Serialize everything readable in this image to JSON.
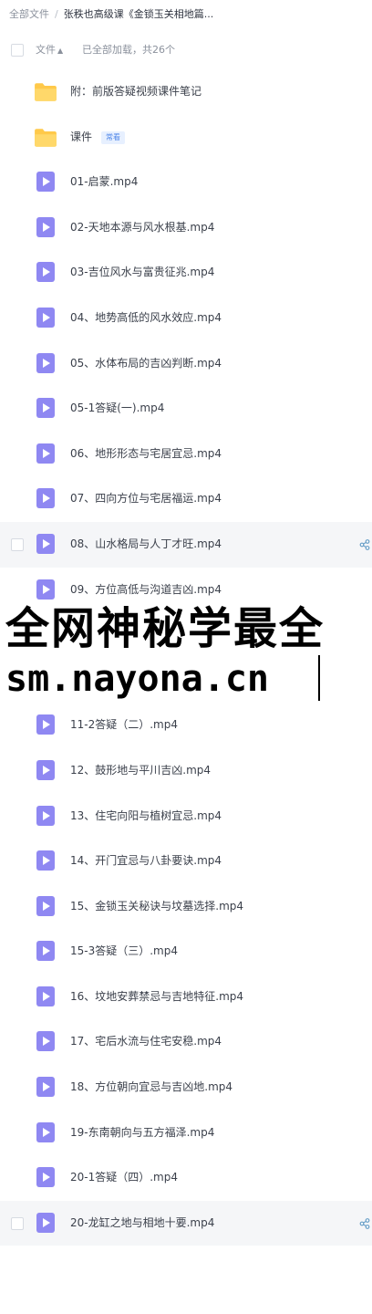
{
  "breadcrumb": {
    "root": "全部文件",
    "separator": "/",
    "current": "张秩也高级课《金锁玉关相地篇..."
  },
  "header": {
    "sort_label": "文件",
    "sort_arrow": "▲",
    "count_label": "已全部加载，共26个"
  },
  "items": [
    {
      "name": "附：前版答疑视频课件笔记",
      "type": "folder",
      "highlighted": false
    },
    {
      "name": "课件",
      "type": "folder",
      "tag": "常看",
      "highlighted": false
    },
    {
      "name": "01-启蒙.mp4",
      "type": "video",
      "highlighted": false
    },
    {
      "name": "02-天地本源与风水根基.mp4",
      "type": "video",
      "highlighted": false
    },
    {
      "name": "03-吉位风水与富贵征兆.mp4",
      "type": "video",
      "highlighted": false
    },
    {
      "name": "04、地势高低的风水效应.mp4",
      "type": "video",
      "highlighted": false
    },
    {
      "name": "05、水体布局的吉凶判断.mp4",
      "type": "video",
      "highlighted": false
    },
    {
      "name": "05-1答疑(一).mp4",
      "type": "video",
      "highlighted": false
    },
    {
      "name": "06、地形形态与宅居宜忌.mp4",
      "type": "video",
      "highlighted": false
    },
    {
      "name": "07、四向方位与宅居福运.mp4",
      "type": "video",
      "highlighted": false
    },
    {
      "name": "08、山水格局与人丁才旺.mp4",
      "type": "video",
      "highlighted": true
    },
    {
      "name": "09、方位高低与沟道吉凶.mp4",
      "type": "video",
      "highlighted": false
    },
    {
      "name": "",
      "type": "hidden",
      "highlighted": false
    },
    {
      "name": "",
      "type": "hidden",
      "highlighted": false
    },
    {
      "name": "11-2答疑（二）.mp4",
      "type": "video",
      "highlighted": false
    },
    {
      "name": "12、鼓形地与平川吉凶.mp4",
      "type": "video",
      "highlighted": false
    },
    {
      "name": "13、住宅向阳与植树宜忌.mp4",
      "type": "video",
      "highlighted": false
    },
    {
      "name": "14、开门宜忌与八卦要诀.mp4",
      "type": "video",
      "highlighted": false
    },
    {
      "name": "15、金锁玉关秘诀与坟墓选择.mp4",
      "type": "video",
      "highlighted": false
    },
    {
      "name": "15-3答疑（三）.mp4",
      "type": "video",
      "highlighted": false
    },
    {
      "name": "16、坟地安葬禁忌与吉地特征.mp4",
      "type": "video",
      "highlighted": false
    },
    {
      "name": "17、宅后水流与住宅安稳.mp4",
      "type": "video",
      "highlighted": false
    },
    {
      "name": "18、方位朝向宜忌与吉凶地.mp4",
      "type": "video",
      "highlighted": false
    },
    {
      "name": "19-东南朝向与五方福泽.mp4",
      "type": "video",
      "highlighted": false
    },
    {
      "name": "20-1答疑（四）.mp4",
      "type": "video",
      "highlighted": false
    },
    {
      "name": "20-龙缸之地与相地十要.mp4",
      "type": "video",
      "highlighted": true
    }
  ],
  "watermark": {
    "line1": "全网神秘学最全",
    "line2": "sm.nayona.cn"
  },
  "colors": {
    "folder": "#ffc94a",
    "video": "#8f88f2",
    "share": "#6aa0c8",
    "highlight_row": "#f5f6f8"
  },
  "icons": {
    "folder": "folder-icon",
    "video": "video-file-icon",
    "share": "share-icon"
  }
}
